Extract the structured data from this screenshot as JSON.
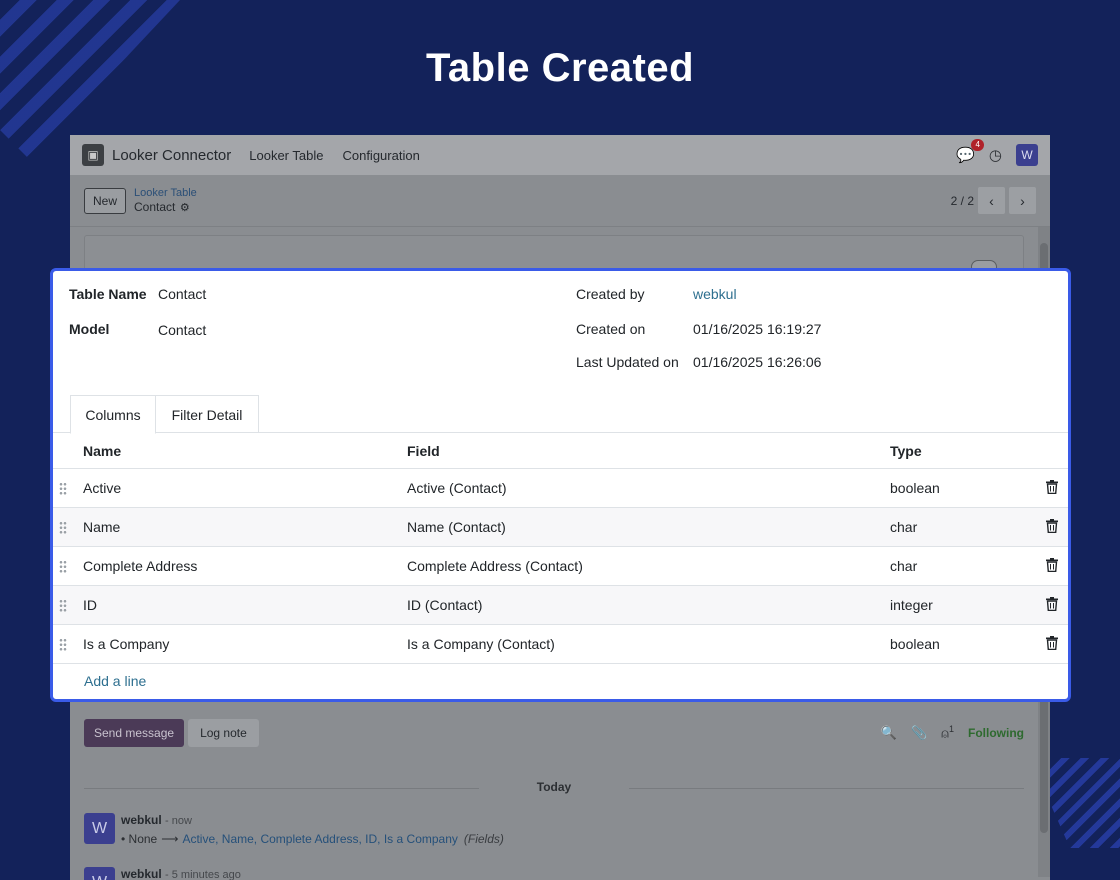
{
  "hero": {
    "title": "Table Created"
  },
  "navbar": {
    "app_name": "Looker Connector",
    "menu": [
      "Looker Table",
      "Configuration"
    ],
    "chat_badge": "4",
    "avatar_letter": "W"
  },
  "control_panel": {
    "new_label": "New",
    "breadcrumb_parent": "Looker Table",
    "breadcrumb_current": "Contact",
    "pager": "2 / 2"
  },
  "form": {
    "table_name_label": "Table Name",
    "table_name_value": "Contact",
    "model_label": "Model",
    "model_value": "Contact",
    "created_by_label": "Created by",
    "created_by_value": "webkul",
    "created_on_label": "Created on",
    "created_on_value": "01/16/2025 16:19:27",
    "updated_on_label": "Last Updated on",
    "updated_on_value": "01/16/2025 16:26:06"
  },
  "tabs": [
    "Columns",
    "Filter Detail"
  ],
  "table": {
    "headers": {
      "name": "Name",
      "field": "Field",
      "type": "Type"
    },
    "rows": [
      {
        "name": "Active",
        "field": "Active (Contact)",
        "type": "boolean"
      },
      {
        "name": "Name",
        "field": "Name (Contact)",
        "type": "char"
      },
      {
        "name": "Complete Address",
        "field": "Complete Address (Contact)",
        "type": "char"
      },
      {
        "name": "ID",
        "field": "ID (Contact)",
        "type": "integer"
      },
      {
        "name": "Is a Company",
        "field": "Is a Company (Contact)",
        "type": "boolean"
      }
    ],
    "add_line": "Add a line"
  },
  "chatter": {
    "send_message": "Send message",
    "log_note": "Log note",
    "followers_count": "1",
    "following": "Following",
    "day_separator": "Today",
    "messages": [
      {
        "avatar_letter": "W",
        "author": "webkul",
        "time": "- now",
        "old_value": "None",
        "new_value": "Active, Name, Complete Address, ID, Is a Company",
        "field": "(Fields)"
      },
      {
        "avatar_letter": "W",
        "author": "webkul",
        "time": "- 5 minutes ago"
      }
    ]
  },
  "colors": {
    "background": "#13225a",
    "highlight_border": "#3a5be8",
    "link": "#2d6f8f"
  }
}
